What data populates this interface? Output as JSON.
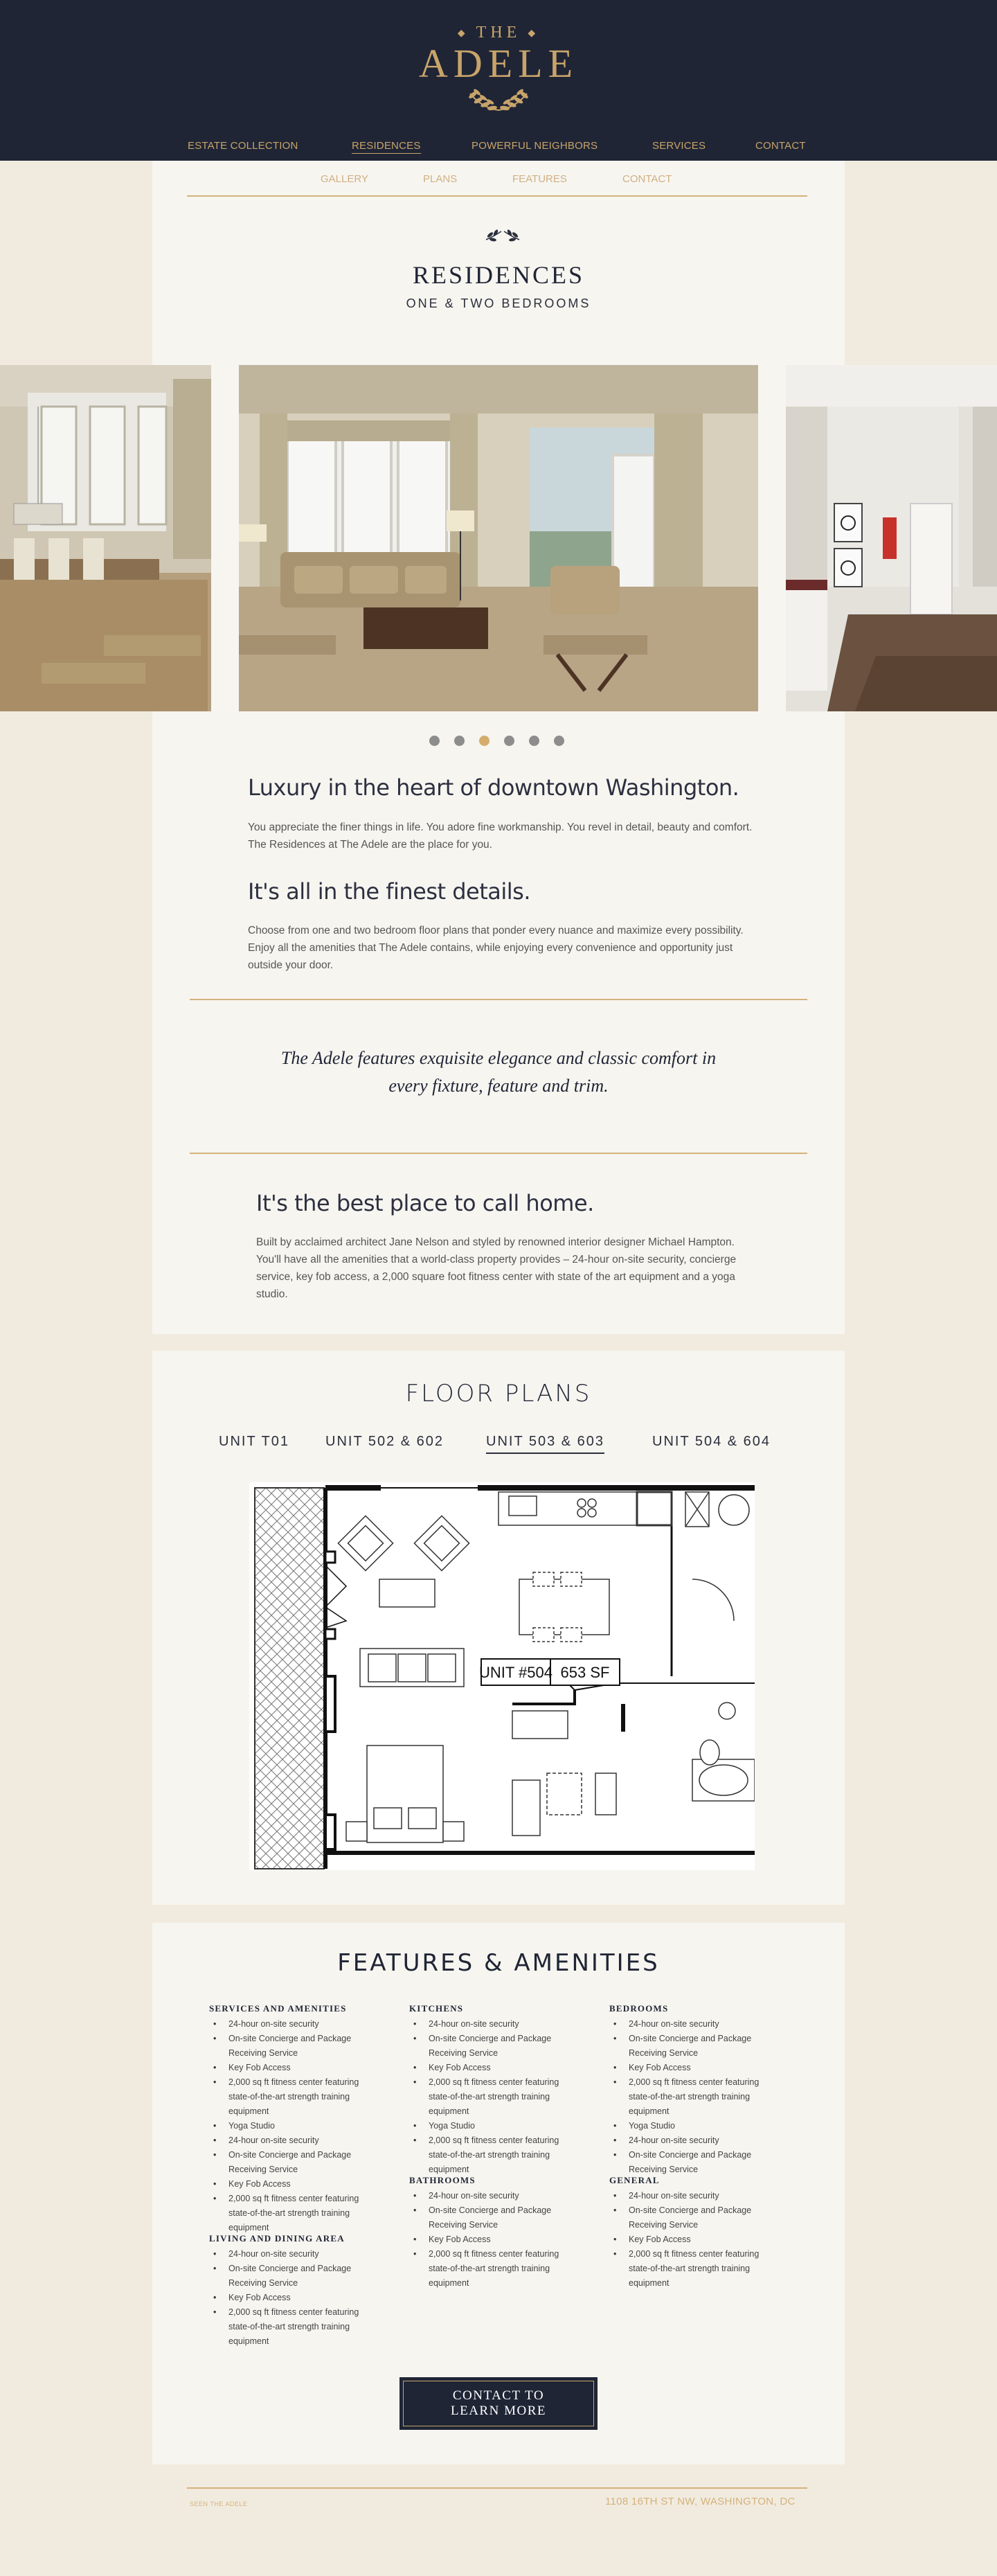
{
  "header": {
    "logo_the": "THE",
    "logo_name": "ADELE",
    "nav": [
      {
        "label": "ESTATE COLLECTION"
      },
      {
        "label": "RESIDENCES",
        "active": true
      },
      {
        "label": "POWERFUL NEIGHBORS"
      },
      {
        "label": "SERVICES"
      },
      {
        "label": "CONTACT"
      }
    ]
  },
  "subnav": [
    "GALLERY",
    "PLANS",
    "FEATURES",
    "CONTACT"
  ],
  "residences": {
    "title": "RESIDENCES",
    "subtitle": "ONE & TWO BEDROOMS",
    "carousel_active_index": 2,
    "carousel_count": 6
  },
  "intro": {
    "heading1": "Luxury in the heart of downtown Washington.",
    "para1": "You appreciate the finer things in life. You adore fine workmanship. You revel in detail, beauty and comfort. The Residences at The Adele are the place for you.",
    "heading2": "It's all in the finest details.",
    "para2": "Choose from one and two bedroom floor plans that ponder every nuance and maximize every possibility. Enjoy all the amenities that The Adele contains, while enjoying every convenience and opportunity just outside your door.",
    "quote_line1": "The Adele features exquisite elegance and classic comfort in",
    "quote_line2": "every fixture, feature and trim.",
    "heading3": "It's the best place to call home.",
    "para3": "Built by acclaimed architect Jane Nelson and styled by renowned interior designer Michael Hampton. You'll have all the amenities that a world-class property provides – 24-hour on-site security, concierge service, key fob access, a 2,000 square foot fitness center with state of the art equipment and a yoga studio."
  },
  "floor_plans": {
    "title": "FLOOR PLANS",
    "tabs": [
      {
        "label": "UNIT T01"
      },
      {
        "label": "UNIT 502 & 602"
      },
      {
        "label": "UNIT 503 & 603",
        "active": true
      },
      {
        "label": "UNIT 504 & 604"
      }
    ],
    "plan_unit": "UNIT #504",
    "plan_area": "653 SF"
  },
  "features": {
    "title": "FEATURES & AMENITIES",
    "categories": [
      {
        "title": "SERVICES AND AMENITIES",
        "items": [
          "24-hour on-site security",
          "On-site Concierge and Package Receiving Service",
          "Key Fob Access",
          "2,000 sq ft fitness center featuring state-of-the-art strength training equipment",
          "Yoga Studio",
          "24-hour on-site security",
          "On-site Concierge and Package Receiving Service",
          "Key Fob Access",
          "2,000 sq ft fitness center featuring state-of-the-art strength training equipment"
        ]
      },
      {
        "title": "LIVING AND DINING AREA",
        "items": [
          "24-hour on-site security",
          "On-site Concierge and Package Receiving Service",
          "Key Fob Access",
          "2,000 sq ft fitness center featuring state-of-the-art strength training equipment"
        ]
      },
      {
        "title": "KITCHENS",
        "items": [
          "24-hour on-site security",
          "On-site Concierge and Package Receiving Service",
          "Key Fob Access",
          "2,000 sq ft fitness center featuring state-of-the-art strength training equipment",
          "Yoga Studio",
          "2,000 sq ft fitness center featuring state-of-the-art strength training equipment"
        ]
      },
      {
        "title": "BATHROOMS",
        "items": [
          "24-hour on-site security",
          "On-site Concierge and Package Receiving Service",
          "Key Fob Access",
          "2,000 sq ft fitness center featuring state-of-the-art strength training equipment"
        ]
      },
      {
        "title": "BEDROOMS",
        "items": [
          "24-hour on-site security",
          "On-site Concierge and Package Receiving Service",
          "Key Fob Access",
          "2,000 sq ft fitness center featuring state-of-the-art strength training equipment",
          "Yoga Studio",
          "24-hour on-site security",
          "On-site Concierge and Package Receiving Service"
        ]
      },
      {
        "title": "GENERAL",
        "items": [
          "24-hour on-site security",
          "On-site Concierge and Package Receiving Service",
          "Key Fob Access",
          "2,000 sq ft fitness center featuring state-of-the-art strength training equipment"
        ]
      }
    ],
    "cta_line1": "CONTACT TO",
    "cta_line2": "LEARN MORE"
  },
  "footer": {
    "small": "SEEN THE ADELE",
    "address": "1108 16TH ST NW, WASHINGTON, DC"
  },
  "colors": {
    "navy": "#1f2535",
    "gold": "#c8a46a",
    "cream": "#f1ebdf",
    "panel": "#f7f5f0"
  }
}
